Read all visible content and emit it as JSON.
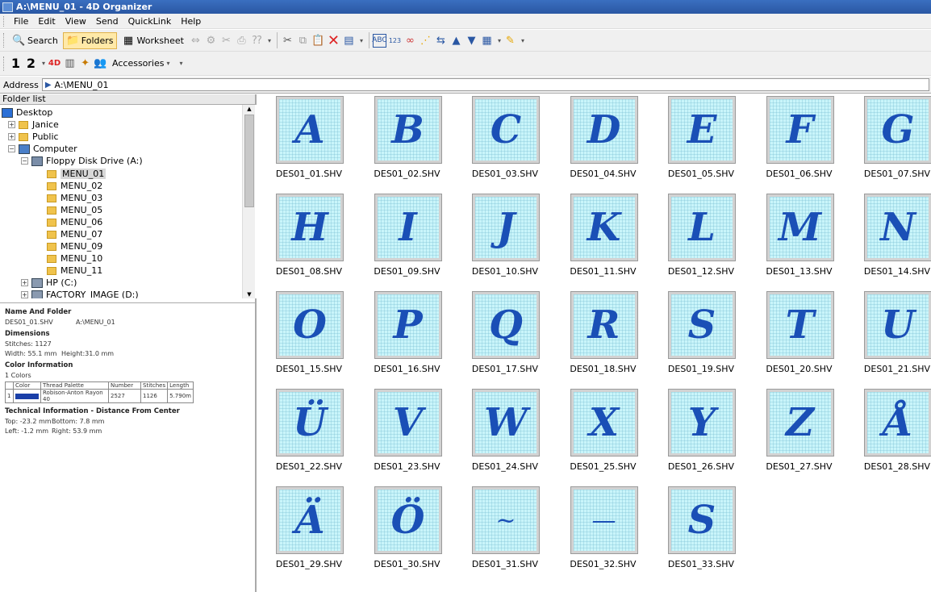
{
  "window": {
    "title": "A:\\MENU_01 - 4D Organizer"
  },
  "menubar": [
    "File",
    "Edit",
    "View",
    "Send",
    "QuickLink",
    "Help"
  ],
  "toolbar": {
    "search_label": "Search",
    "folders_label": "Folders",
    "worksheet_label": "Worksheet",
    "accessories_label": "Accessories",
    "view1_label": "1",
    "view2_label": "2"
  },
  "address": {
    "label": "Address",
    "value": "A:\\MENU_01"
  },
  "folder_list": {
    "header": "Folder list",
    "nodes": [
      {
        "label": "Desktop"
      },
      {
        "label": "Janice"
      },
      {
        "label": "Public"
      },
      {
        "label": "Computer"
      },
      {
        "label": "Floppy Disk Drive (A:)"
      },
      {
        "label": "MENU_01"
      },
      {
        "label": "MENU_02"
      },
      {
        "label": "MENU_03"
      },
      {
        "label": "MENU_05"
      },
      {
        "label": "MENU_06"
      },
      {
        "label": "MENU_07"
      },
      {
        "label": "MENU_09"
      },
      {
        "label": "MENU_10"
      },
      {
        "label": "MENU_11"
      },
      {
        "label": "HP (C:)"
      },
      {
        "label": "FACTORY_IMAGE (D:)"
      }
    ]
  },
  "info": {
    "name_heading": "Name And Folder",
    "file_name": "DES01_01.SHV",
    "folder_path": "A:\\MENU_01",
    "dimensions_heading": "Dimensions",
    "stitches": "Stitches: 1127",
    "width": "Width: 55.1 mm",
    "height": "Height:31.0 mm",
    "color_heading": "Color Information",
    "colors_count": "1 Colors",
    "table_headers": [
      "Color",
      "Thread Palette",
      "Number",
      "Stitches",
      "Length"
    ],
    "table_row": {
      "index": "1",
      "palette": "Robison-Anton Rayon 40",
      "number": "2527",
      "stitches": "1126",
      "length": "5.790m",
      "swatch": "#1a3fa8"
    },
    "tech_heading": "Technical Information - Distance From Center",
    "top": "Top: -23.2 mm",
    "bottom": "Bottom: 7.8 mm",
    "left": "Left: -1.2 mm",
    "right": "Right: 53.9 mm"
  },
  "colors": {
    "thumb_bg": "#c9f5fa",
    "stitch": "#1a4fb6",
    "selection": "#d8d8d8"
  },
  "files": [
    {
      "name": "DES01_01.SHV",
      "glyph": "A"
    },
    {
      "name": "DES01_02.SHV",
      "glyph": "B"
    },
    {
      "name": "DES01_03.SHV",
      "glyph": "C"
    },
    {
      "name": "DES01_04.SHV",
      "glyph": "D"
    },
    {
      "name": "DES01_05.SHV",
      "glyph": "E"
    },
    {
      "name": "DES01_06.SHV",
      "glyph": "F"
    },
    {
      "name": "DES01_07.SHV",
      "glyph": "G"
    },
    {
      "name": "DES01_08.SHV",
      "glyph": "H"
    },
    {
      "name": "DES01_09.SHV",
      "glyph": "I"
    },
    {
      "name": "DES01_10.SHV",
      "glyph": "J"
    },
    {
      "name": "DES01_11.SHV",
      "glyph": "K"
    },
    {
      "name": "DES01_12.SHV",
      "glyph": "L"
    },
    {
      "name": "DES01_13.SHV",
      "glyph": "M"
    },
    {
      "name": "DES01_14.SHV",
      "glyph": "N"
    },
    {
      "name": "DES01_15.SHV",
      "glyph": "O"
    },
    {
      "name": "DES01_16.SHV",
      "glyph": "P"
    },
    {
      "name": "DES01_17.SHV",
      "glyph": "Q"
    },
    {
      "name": "DES01_18.SHV",
      "glyph": "R"
    },
    {
      "name": "DES01_19.SHV",
      "glyph": "S"
    },
    {
      "name": "DES01_20.SHV",
      "glyph": "T"
    },
    {
      "name": "DES01_21.SHV",
      "glyph": "U"
    },
    {
      "name": "DES01_22.SHV",
      "glyph": "Ü"
    },
    {
      "name": "DES01_23.SHV",
      "glyph": "V"
    },
    {
      "name": "DES01_24.SHV",
      "glyph": "W"
    },
    {
      "name": "DES01_25.SHV",
      "glyph": "X"
    },
    {
      "name": "DES01_26.SHV",
      "glyph": "Y"
    },
    {
      "name": "DES01_27.SHV",
      "glyph": "Z"
    },
    {
      "name": "DES01_28.SHV",
      "glyph": "Å"
    },
    {
      "name": "DES01_29.SHV",
      "glyph": "Ä"
    },
    {
      "name": "DES01_30.SHV",
      "glyph": "Ö"
    },
    {
      "name": "DES01_31.SHV",
      "glyph": "~"
    },
    {
      "name": "DES01_32.SHV",
      "glyph": "—"
    },
    {
      "name": "DES01_33.SHV",
      "glyph": "S"
    }
  ]
}
